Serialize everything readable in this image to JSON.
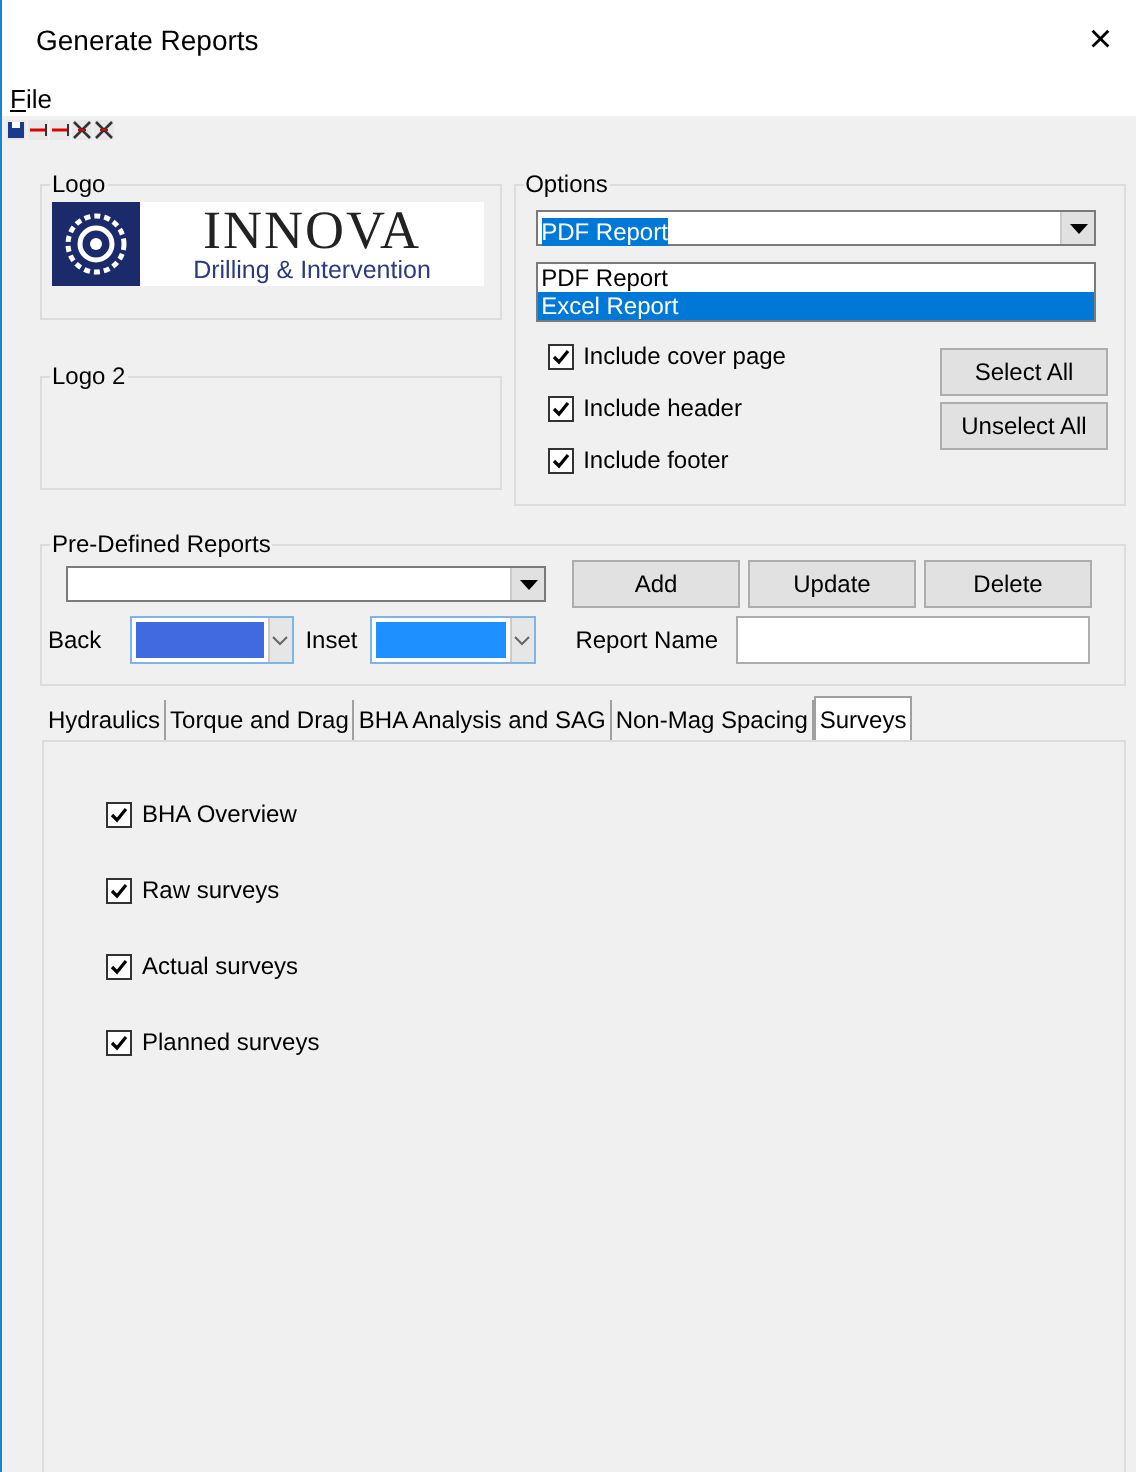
{
  "window": {
    "title": "Generate Reports",
    "close": "×"
  },
  "menu": [
    {
      "label": "File",
      "access_key_underlined": true
    }
  ],
  "logo_group": {
    "label": "Logo",
    "logo": {
      "title": "INNOVA",
      "subtitle": "Drilling & Intervention"
    }
  },
  "logo2_group": {
    "label": "Logo 2"
  },
  "options": {
    "label": "Options",
    "format_select": {
      "value": "PDF Report",
      "expanded": true,
      "options": [
        {
          "label": "PDF Report",
          "highlighted": false
        },
        {
          "label": "Excel Report",
          "highlighted": true
        }
      ]
    },
    "checkboxes": [
      {
        "label": "Include cover page",
        "checked": true
      },
      {
        "label": "Include header",
        "checked": true
      },
      {
        "label": "Include footer",
        "checked": true
      }
    ],
    "buttons": [
      "Select All",
      "Unselect All"
    ]
  },
  "predefined": {
    "label": "Pre-Defined Reports",
    "buttons": [
      "Add",
      "Update",
      "Delete"
    ],
    "back": {
      "label": "Back",
      "color": "#4169e1"
    },
    "inset": {
      "label": "Inset",
      "color": "#1e90ff"
    },
    "report_name": {
      "label": "Report Name"
    }
  },
  "tabs": [
    {
      "label": "Hydraulics",
      "selected": false
    },
    {
      "label": "Torque and Drag",
      "selected": false
    },
    {
      "label": "BHA Analysis and SAG",
      "selected": false
    },
    {
      "label": "Non-Mag Spacing",
      "selected": false
    },
    {
      "label": "Surveys",
      "selected": true
    }
  ],
  "surveys": [
    {
      "label": "BHA Overview",
      "checked": true
    },
    {
      "label": "Raw surveys",
      "checked": true
    },
    {
      "label": "Actual surveys",
      "checked": true
    },
    {
      "label": "Planned surveys",
      "checked": true
    }
  ]
}
